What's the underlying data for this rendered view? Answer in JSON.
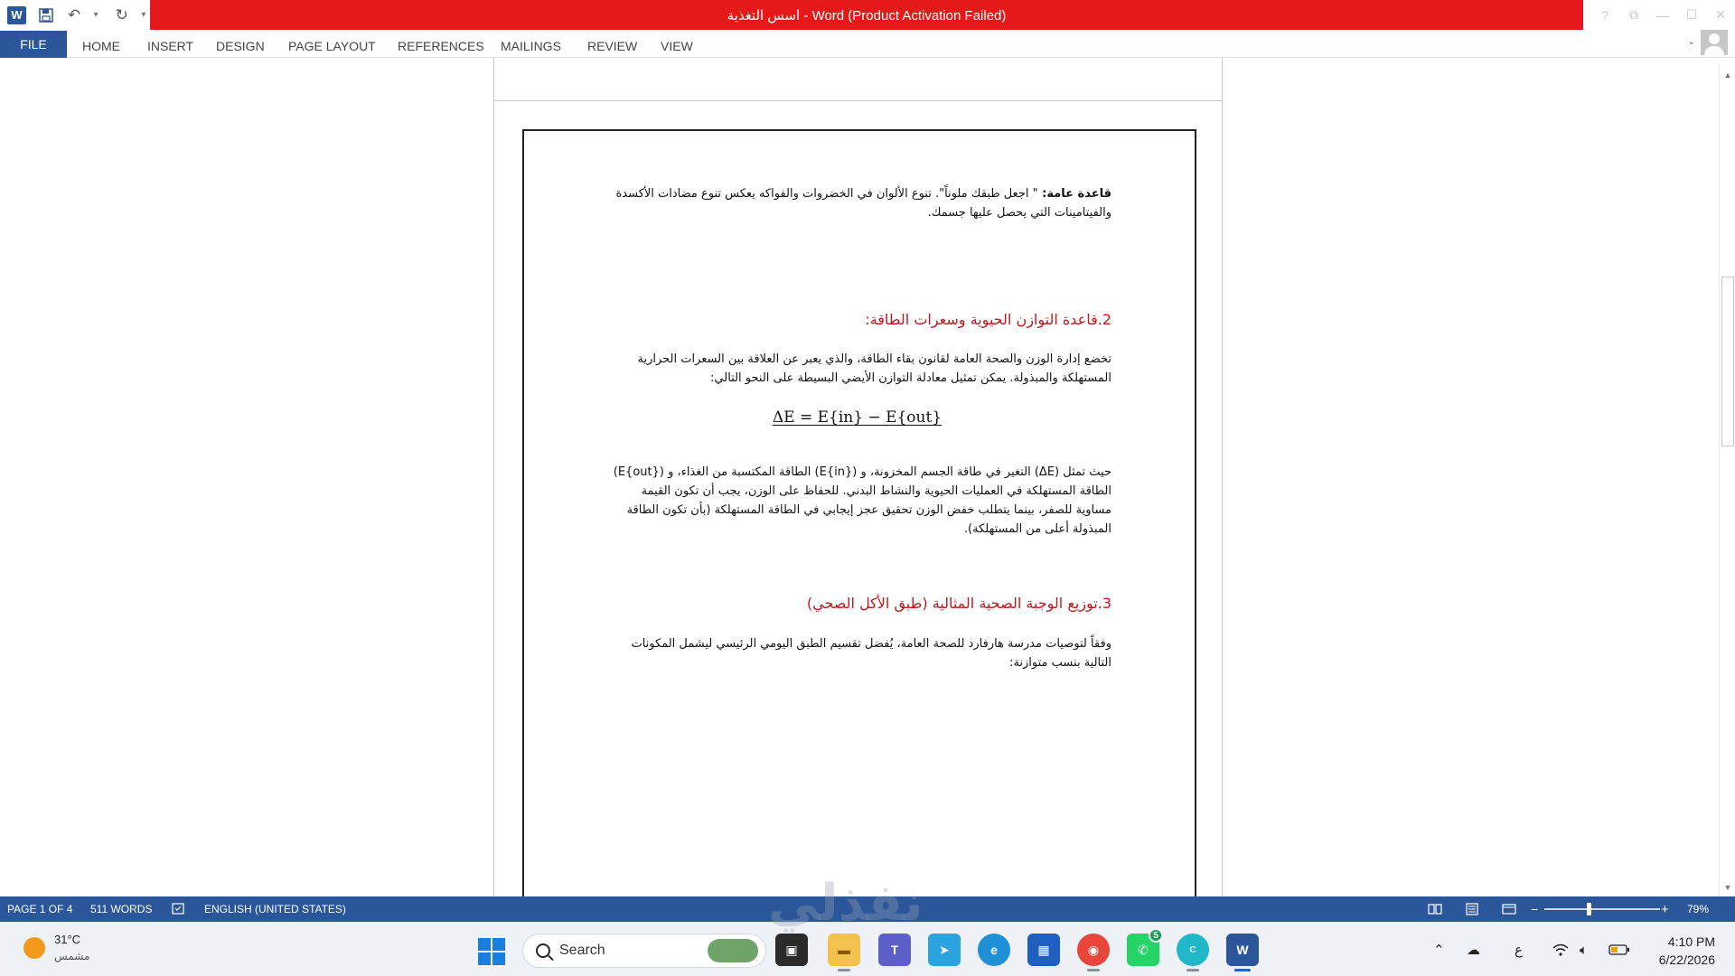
{
  "window": {
    "title": "اسس التغذية  -  Word (Product Activation Failed)",
    "controls": [
      "?",
      "⧉",
      "—",
      "☐",
      "✕"
    ]
  },
  "quick_access": {
    "app_icon": "W",
    "save_icon": "save-icon",
    "undo_icon": "undo-icon",
    "redo_icon": "redo-icon"
  },
  "ribbon": {
    "tabs": [
      "FILE",
      "HOME",
      "INSERT",
      "DESIGN",
      "PAGE LAYOUT",
      "REFERENCES",
      "MAILINGS",
      "REVIEW",
      "VIEW"
    ]
  },
  "document": {
    "para1_bold": "قاعدة عامة: ",
    "para1_text": "\" اجعل طبقك ملوناً\". تنوع الألوان في الخضروات والفواكه يعكس تنوع مضادات الأكسدة والفيتامينات التي يحصل عليها جسمك.",
    "heading2": "2.قاعدة التوازن الحيوية وسعرات الطاقة:",
    "para2": "تخضع إدارة الوزن والصحة العامة لقانون بقاء الطاقة، والذي يعبر عن العلاقة بين السعرات الحرارية المستهلكة والمبذولة. يمكن تمثيل معادلة التوازن الأيضي البسيطة على النحو التالي:",
    "equation": "ΔE = E{in} − E{out}",
    "para3": "حيث تمثل (ΔE) التغير في طاقة الجسم المخزونة، و (E{in}) الطاقة المكتسبة من الغذاء، و (E{out}) الطاقة المستهلكة في العمليات الحيوية والنشاط البدني. للحفاظ على الوزن، يجب أن تكون القيمة مساوية للصفر، بينما يتطلب خفض الوزن تحقيق عجز إيجابي في الطاقة المستهلكة (بأن تكون الطاقة المبذولة أعلى من المستهلكة).",
    "heading3": "3.توزيع الوجبة الصحية المثالية (طبق الأكل الصحي)",
    "para4": "وفقاً لتوصيات مدرسة هارفارد للصحة العامة، يُفضل تقسيم الطبق اليومي الرئيسي ليشمل المكونات التالية بنسب متوازنة:"
  },
  "statusbar": {
    "page": "PAGE 1 OF 4",
    "words": "511 WORDS",
    "language": "ENGLISH (UNITED STATES)",
    "zoom": "79%",
    "zoom_level_percent": 79
  },
  "taskbar": {
    "temperature": "31°C",
    "condition": "مشمس",
    "search_placeholder": "Search",
    "whatsapp_badge": "5",
    "input_lang": "ع",
    "time": "4:10 PM",
    "date": "6/22/2026"
  },
  "watermark": "نفذلي",
  "colors": {
    "title_bar": "#e51919",
    "ribbon_accent": "#2b579a",
    "heading": "#c0171c",
    "statusbar": "#2b579a"
  }
}
